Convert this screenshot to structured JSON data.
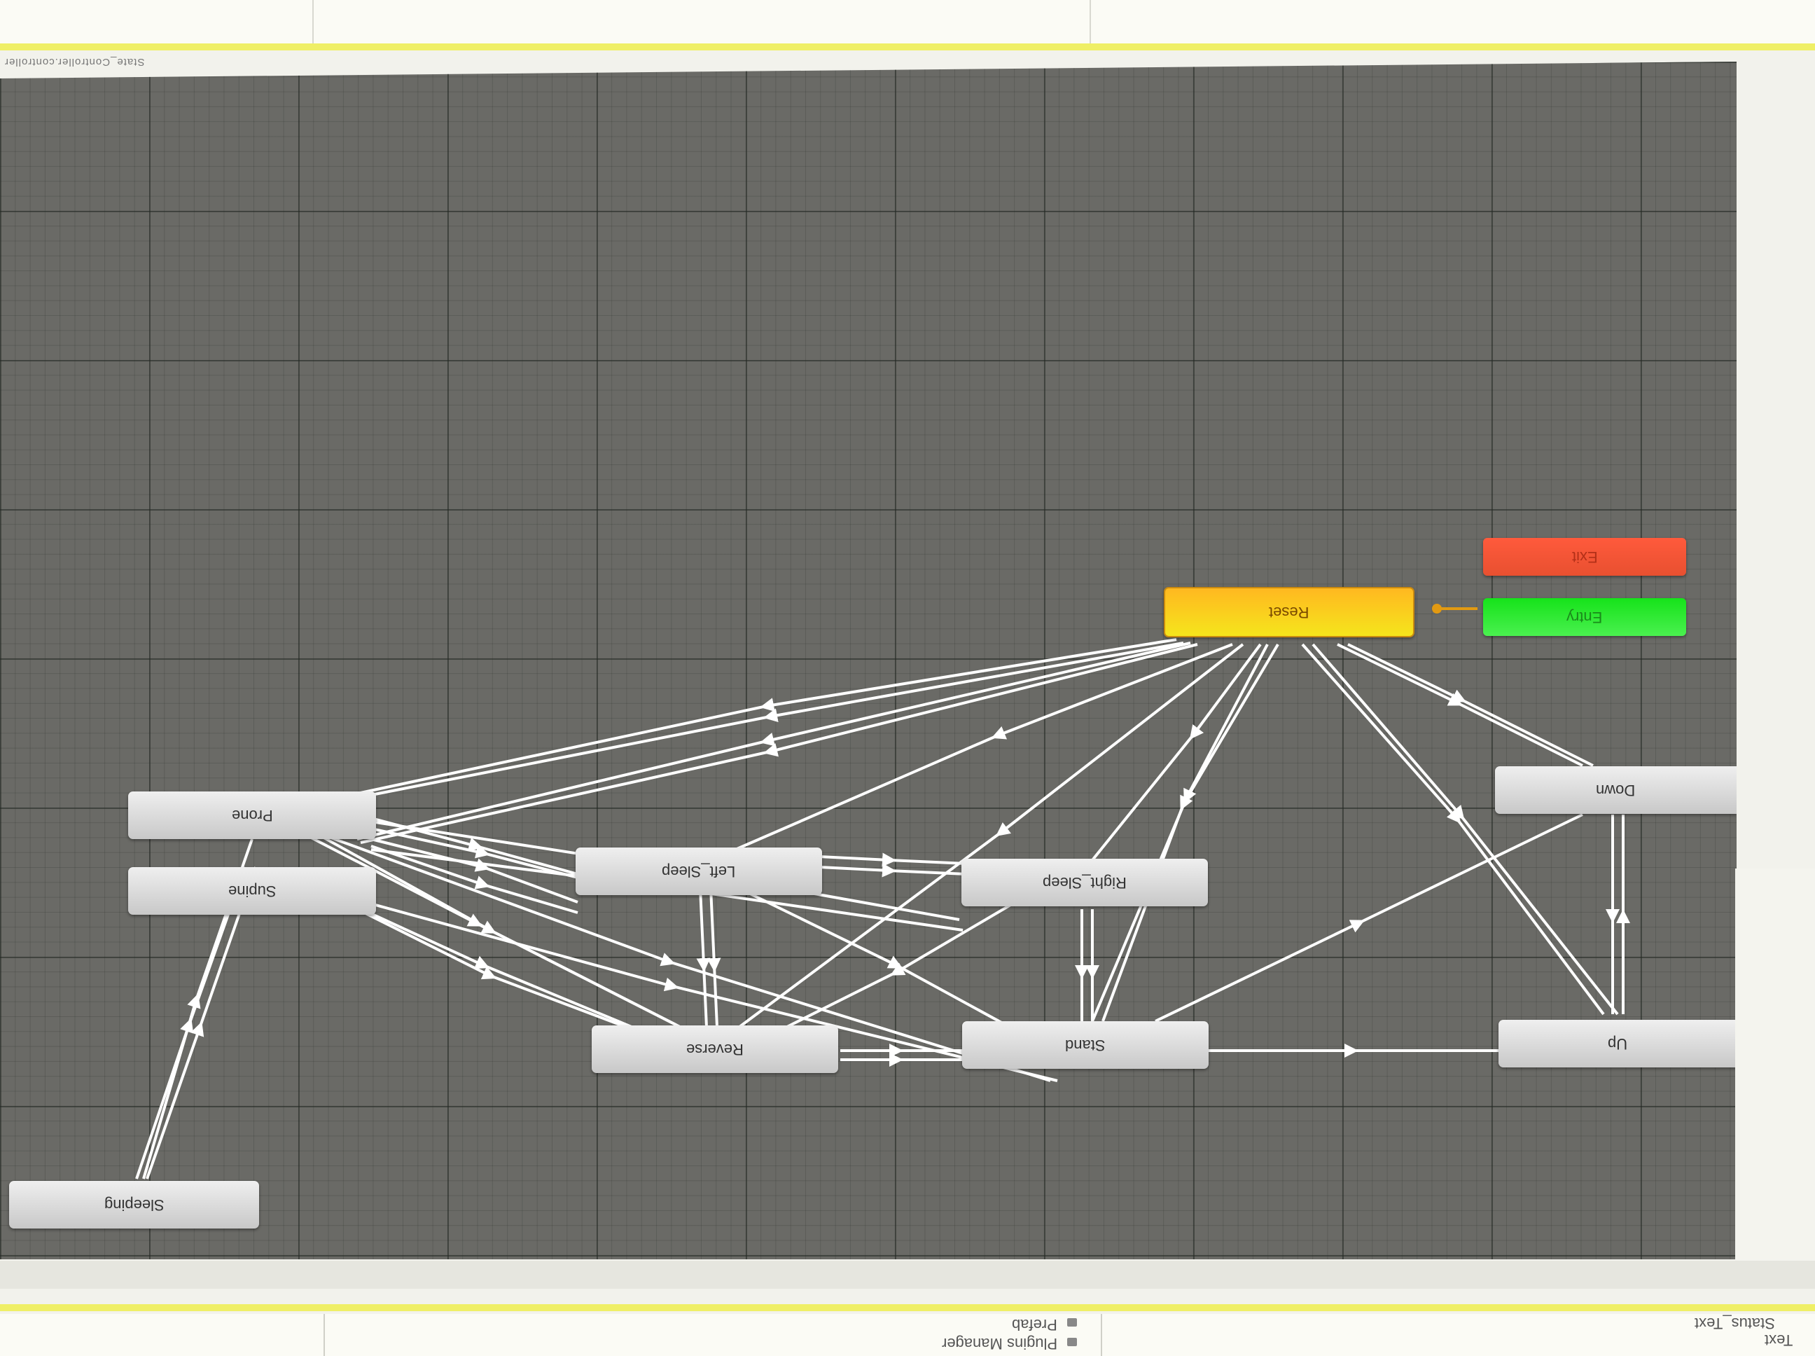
{
  "window": {
    "status_path": "State_Controller.controller"
  },
  "states": {
    "reset": "Reset",
    "exit": "Exit",
    "entry": "Entry",
    "down": "Down",
    "up": "Up",
    "prone": "Prone",
    "supine": "Supine",
    "left_sleep": "Left_Sleep",
    "right_sleep": "Right_Sleep",
    "reverse": "Reverse",
    "stand": "Stand",
    "sleeping": "Sleeping"
  },
  "footer": {
    "right_items": [
      "Text",
      "Status_Text"
    ],
    "left_items": [
      "Prefab",
      "Plugins Manager"
    ]
  },
  "colors": {
    "reset": "#f5c518",
    "exit": "#f05535",
    "entry": "#22e626",
    "canvas": "#6a6a66",
    "accent": "#efef66"
  }
}
